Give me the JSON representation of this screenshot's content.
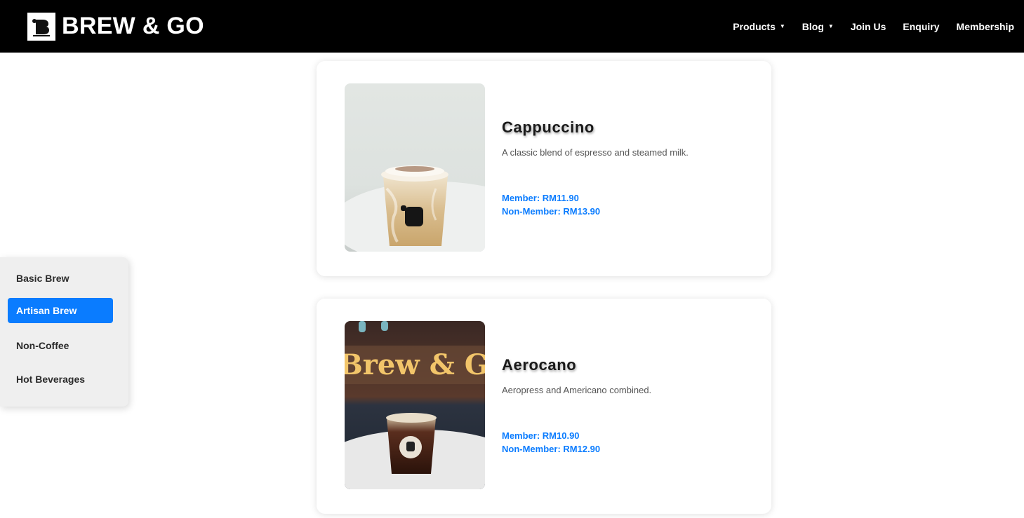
{
  "header": {
    "brand": "BREW & GO",
    "nav": [
      {
        "label": "Products",
        "has_dropdown": true
      },
      {
        "label": "Blog",
        "has_dropdown": true
      },
      {
        "label": "Join Us",
        "has_dropdown": false
      },
      {
        "label": "Enquiry",
        "has_dropdown": false
      },
      {
        "label": "Membership",
        "has_dropdown": false
      }
    ],
    "dropdown_glyph": "▼"
  },
  "sidebar": {
    "items": [
      {
        "label": "Basic Brew",
        "active": false
      },
      {
        "label": "Artisan Brew",
        "active": true
      },
      {
        "label": "Non-Coffee",
        "active": false
      },
      {
        "label": "Hot Beverages",
        "active": false
      }
    ]
  },
  "products": [
    {
      "name": "Cappuccino",
      "description": "A classic blend of espresso and steamed milk.",
      "member_price": "Member: RM11.90",
      "non_member_price": "Non-Member: RM13.90"
    },
    {
      "name": "Aerocano",
      "description": "Aeropress and Americano combined.",
      "member_price": "Member: RM10.90",
      "non_member_price": "Non-Member: RM12.90",
      "photo_sign_text": "Brew & Go"
    }
  ],
  "colors": {
    "header_bg": "#000000",
    "accent": "#0a7cff",
    "sidebar_bg": "#efefef"
  },
  "icons": {
    "logo": "brew-and-go-logo-icon",
    "dropdown": "caret-down-icon"
  }
}
